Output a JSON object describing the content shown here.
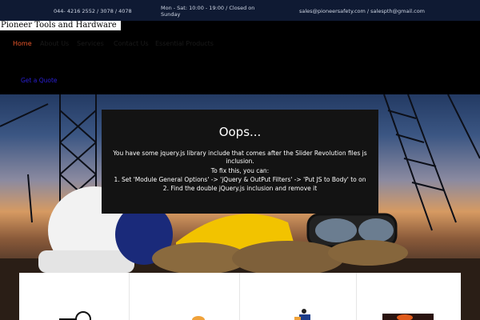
{
  "topbar": {
    "phone": "044- 4216 2552 / 3078 / 4078",
    "hours": "Mon - Sat: 10:00 - 19:00 / Closed on Sunday",
    "email": "sales@pioneersafety.com / salespth@gmail.com"
  },
  "header": {
    "logo_text": "Pioneer Tools and Hardware",
    "nav": [
      {
        "label": "Home",
        "active": true
      },
      {
        "label": "About Us",
        "active": false
      },
      {
        "label": "Services",
        "active": false
      },
      {
        "label": "Contact Us",
        "active": false
      },
      {
        "label": "Essential Products",
        "active": false
      }
    ],
    "cta": "Get a Quote"
  },
  "slider_error": {
    "title": "Oops...",
    "lines": [
      "You have some jquery.js library include that comes after the Slider Revolution files js",
      "inclusion.",
      "To fix this, you can:",
      "1. Set 'Module General Options' -> 'jQuery & OutPut Filters' -> 'Put JS to Body' to on",
      "2. Find the double jQuery.js inclusion and remove it"
    ]
  },
  "hero": {
    "image_subject": "construction-safety-gear",
    "colors": {
      "hardhat": "#f4f4f4",
      "helmet_yellow": "#f2c300",
      "gloves": "#8a6a3e"
    }
  },
  "cards": {
    "icons": [
      "tape-measure-icon",
      "safety-helmet-icon",
      "worker-figure-icon",
      "fire-icon"
    ]
  },
  "colors": {
    "topbar_bg": "#0f1a33",
    "nav_active": "#e8562a",
    "cta": "#2a1fd6",
    "dialog_bg": "#131313"
  }
}
